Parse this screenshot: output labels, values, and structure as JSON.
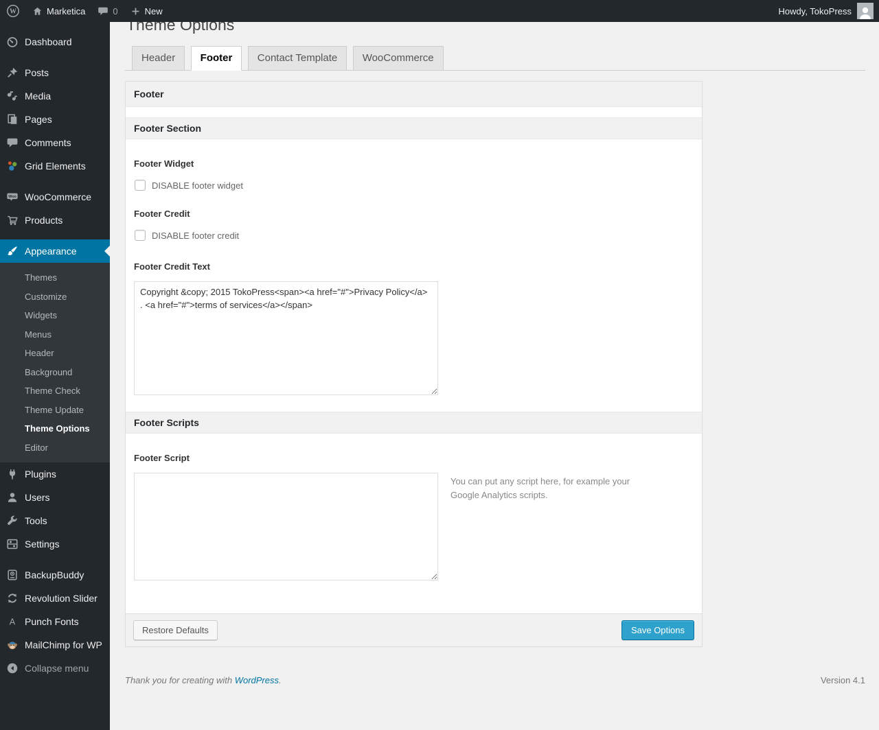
{
  "admin_bar": {
    "site_name": "Marketica",
    "comments_count": "0",
    "new_label": "New",
    "howdy": "Howdy, TokoPress"
  },
  "sidebar": {
    "menu": [
      {
        "label": "Dashboard"
      },
      {
        "label": "Posts"
      },
      {
        "label": "Media"
      },
      {
        "label": "Pages"
      },
      {
        "label": "Comments"
      },
      {
        "label": "Grid Elements"
      },
      {
        "label": "WooCommerce"
      },
      {
        "label": "Products"
      },
      {
        "label": "Appearance",
        "active": true
      },
      {
        "label": "Plugins"
      },
      {
        "label": "Users"
      },
      {
        "label": "Tools"
      },
      {
        "label": "Settings"
      },
      {
        "label": "BackupBuddy"
      },
      {
        "label": "Revolution Slider"
      },
      {
        "label": "Punch Fonts"
      },
      {
        "label": "MailChimp for WP"
      }
    ],
    "appearance_submenu": [
      "Themes",
      "Customize",
      "Widgets",
      "Menus",
      "Header",
      "Background",
      "Theme Check",
      "Theme Update",
      "Theme Options",
      "Editor"
    ],
    "current_submenu_item": "Theme Options",
    "collapse_label": "Collapse menu"
  },
  "page": {
    "title": "Theme Options",
    "tabs": [
      {
        "label": "Header",
        "active": false
      },
      {
        "label": "Footer",
        "active": true
      },
      {
        "label": "Contact Template",
        "active": false
      },
      {
        "label": "WooCommerce",
        "active": false
      }
    ]
  },
  "panel": {
    "group_title": "Footer",
    "section_footer_title": "Footer Section",
    "footer_widget_label": "Footer Widget",
    "disable_widget_label": "DISABLE footer widget",
    "footer_credit_label": "Footer Credit",
    "disable_credit_label": "DISABLE footer credit",
    "footer_credit_text_label": "Footer Credit Text",
    "footer_credit_text_value": "Copyright &copy; 2015 TokoPress<span><a href=\"#\">Privacy Policy</a> . <a href=\"#\">terms of services</a></span>",
    "section_scripts_title": "Footer Scripts",
    "footer_script_label": "Footer Script",
    "footer_script_value": "",
    "footer_script_help": "You can put any script here, for example your Google Analytics scripts.",
    "restore_button_label": "Restore Defaults",
    "save_button_label": "Save Options"
  },
  "footer": {
    "thanks_text": "Thank you for creating with",
    "wordpress_link": "WordPress",
    "period": ".",
    "version": "Version 4.1"
  },
  "colors": {
    "menu_highlight": "#0074a2",
    "primary_button": "#2ea2cc",
    "link": "#0074a2"
  }
}
